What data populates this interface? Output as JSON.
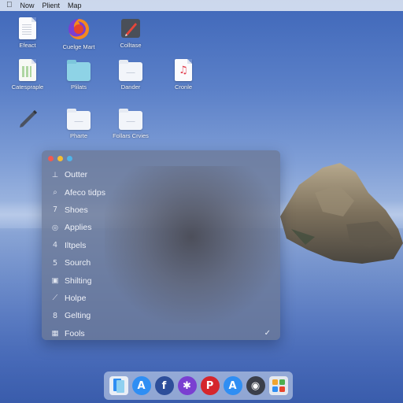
{
  "menubar": {
    "apple": "",
    "items": [
      "Now",
      "Plient",
      "Map"
    ]
  },
  "desktop": {
    "icons": [
      {
        "label": "Efeact",
        "icon": "document-icon"
      },
      {
        "label": "Cuelge Mart",
        "icon": "firefox-icon"
      },
      {
        "label": "Colltase",
        "icon": "pen-app-icon"
      },
      {
        "label": "Catespraple",
        "icon": "spreadsheet-icon"
      },
      {
        "label": "Plilats",
        "icon": "teal-folder-icon"
      },
      {
        "label": "Dander",
        "icon": "folder-icon"
      },
      {
        "label": "Cronle",
        "icon": "music-file-icon"
      },
      {
        "label": "",
        "icon": "pencil-icon"
      },
      {
        "label": "Pharte",
        "icon": "folder-icon"
      },
      {
        "label": "Follars Crvies",
        "icon": "folder-icon"
      }
    ]
  },
  "window": {
    "items": [
      {
        "label": "Outter",
        "icon": "person-icon",
        "glyph": "⊥"
      },
      {
        "label": "Afeco tidps",
        "icon": "search-icon",
        "glyph": "⌕"
      },
      {
        "label": "Shoes",
        "icon": "number-icon",
        "glyph": "7"
      },
      {
        "label": "Applies",
        "icon": "circle-icon",
        "glyph": "◎"
      },
      {
        "label": "Iltpels",
        "icon": "number-icon",
        "glyph": "4"
      },
      {
        "label": "Sourch",
        "icon": "number-icon",
        "glyph": "5"
      },
      {
        "label": "Shilting",
        "icon": "box-icon",
        "glyph": "▣"
      },
      {
        "label": "Holpe",
        "icon": "wand-icon",
        "glyph": "⟋"
      },
      {
        "label": "Gelting",
        "icon": "number-icon",
        "glyph": "8"
      },
      {
        "label": "Fools",
        "icon": "grid-icon",
        "glyph": "▦",
        "checked": "✓"
      }
    ]
  },
  "dock": {
    "items": [
      {
        "icon": "files-icon",
        "color": "#e9eef6"
      },
      {
        "icon": "app-store-icon",
        "color": "#2f8ef3"
      },
      {
        "icon": "facebook-icon",
        "color": "#2d4e9a"
      },
      {
        "icon": "purple-app-icon",
        "color": "#7a3fd1"
      },
      {
        "icon": "pinterest-icon",
        "color": "#d5262c"
      },
      {
        "icon": "app-store-icon",
        "color": "#2f8ef3"
      },
      {
        "icon": "settings-icon",
        "color": "#3b3f4a"
      },
      {
        "icon": "launchpad-icon",
        "color": "#e4e8ef"
      }
    ]
  }
}
